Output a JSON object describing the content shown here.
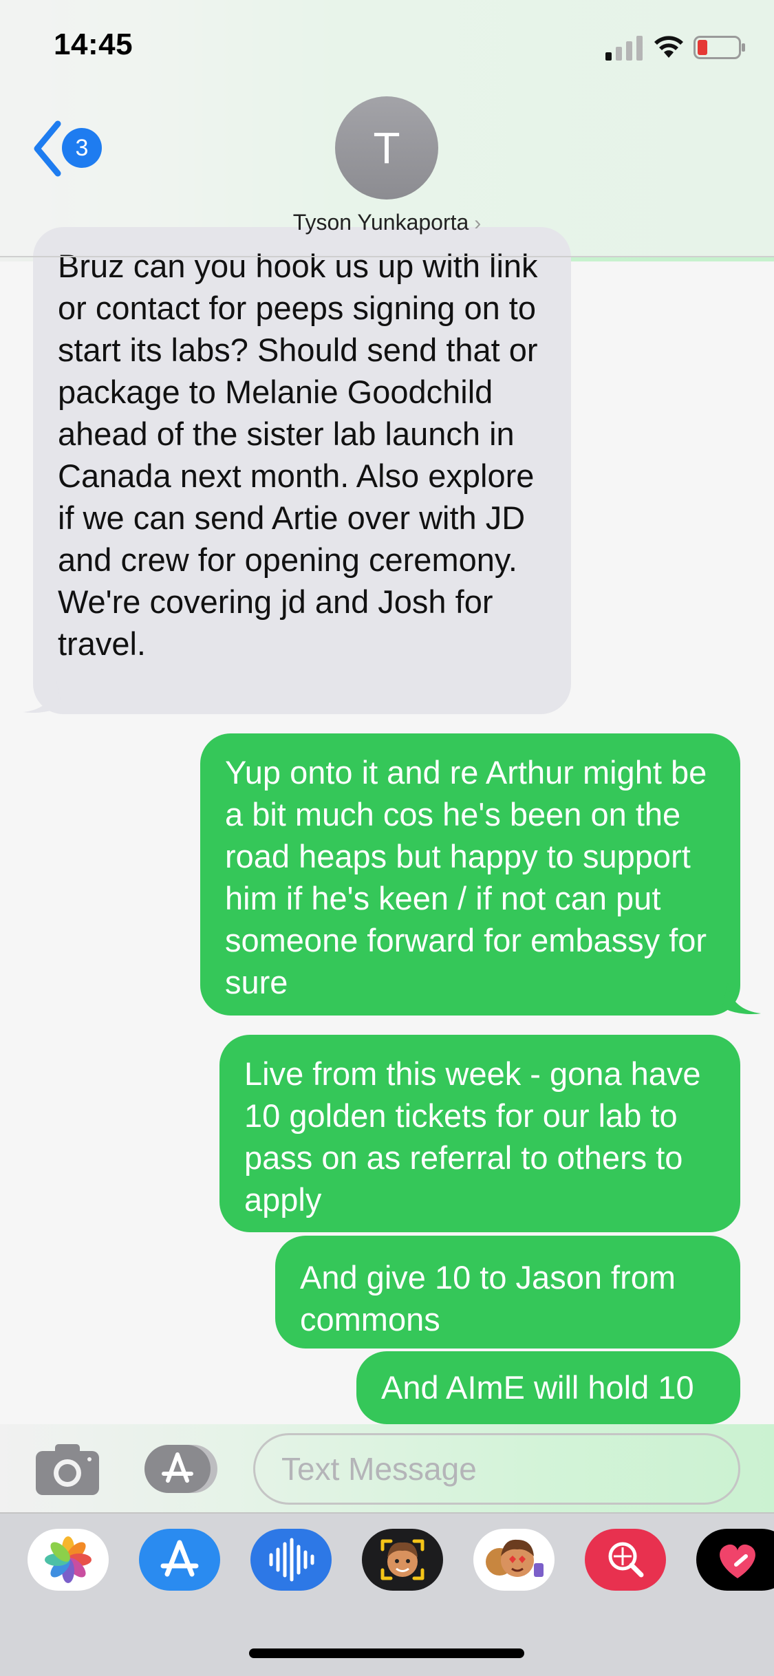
{
  "status_bar": {
    "time": "14:45"
  },
  "header": {
    "back_badge": "3",
    "avatar_initial": "T",
    "contact_name": "Tyson Yunkaporta"
  },
  "messages": [
    {
      "direction": "incoming",
      "text": "Bruz can you hook us up with link or contact for peeps signing on to start its labs? Should send that or package to Melanie Goodchild ahead of the sister lab launch in Canada next month. Also explore if we can send Artie over with JD and crew for opening ceremony. We're covering jd and Josh for travel."
    },
    {
      "direction": "outgoing",
      "text": "Yup onto it and re Arthur might be a bit much cos he's been on the road heaps but happy to support him if he's keen / if not can put someone forward for embassy for sure"
    },
    {
      "direction": "outgoing",
      "text": "Live from this week - gona have 10 golden tickets for our lab to pass on as referral to others to apply"
    },
    {
      "direction": "outgoing",
      "text": "And give 10 to Jason from commons"
    },
    {
      "direction": "outgoing",
      "text": "And AImE will hold 10"
    }
  ],
  "composer": {
    "placeholder": "Text Message"
  },
  "app_drawer": [
    "photos-icon",
    "app-store-icon",
    "audio-message-icon",
    "memoji-icon",
    "animoji-stickers-icon",
    "image-search-icon",
    "digital-touch-icon"
  ],
  "colors": {
    "outgoing": "#35c759",
    "incoming": "#e5e5ea",
    "accent": "#1e7cf0"
  }
}
